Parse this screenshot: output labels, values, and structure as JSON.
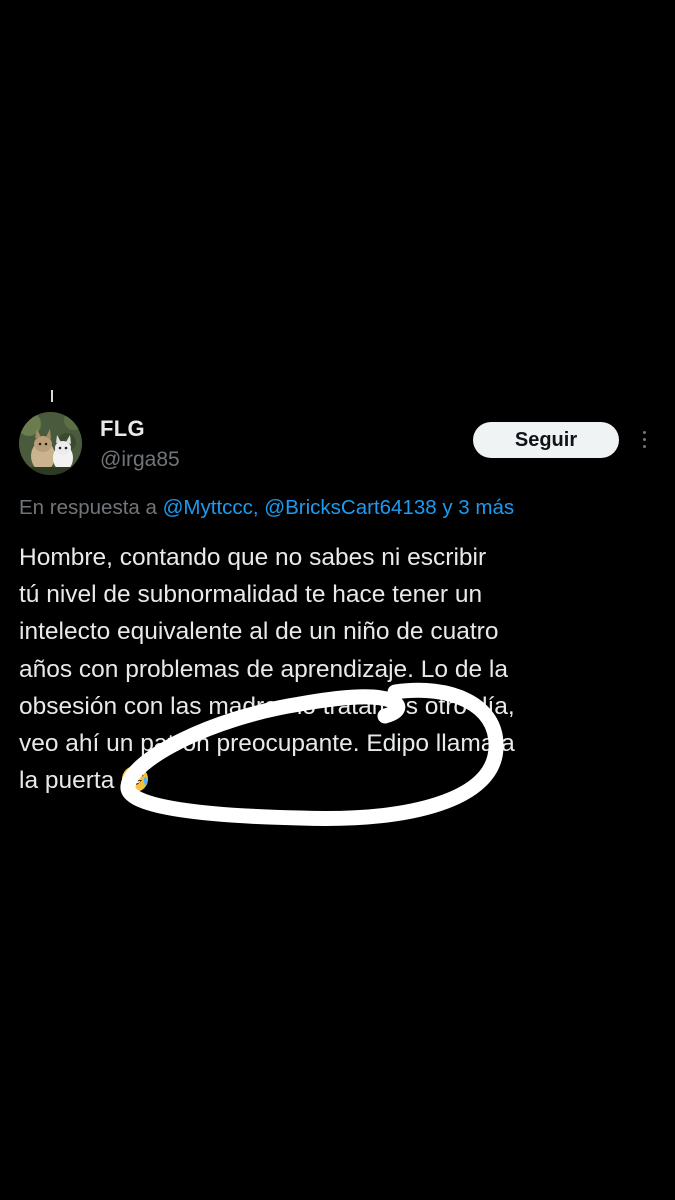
{
  "tweet": {
    "display_name": "FLG",
    "handle": "@irga85",
    "follow_label": "Seguir",
    "reply_prefix": "En respuesta a",
    "reply_mentions": "@Myttccc, @BricksCart64138",
    "reply_and": "y",
    "reply_more": "3 más",
    "body_lines": [
      "Hombre, contando que no sabes ni escribir",
      "tú nivel de subnormalidad te hace tener un",
      "intelecto equivalente al de un niño de cuatro",
      "años con problemas de aprendizaje. Lo de la",
      "obsesión con las madres lo tratamos otro día,",
      "veo ahí un patrón  preocupante. Edipo llama a",
      "la puerta"
    ]
  },
  "icons": {
    "more": "more-vertical-icon",
    "emoji": "face-with-tears-of-joy-icon"
  },
  "colors": {
    "background": "#000000",
    "text_primary": "#e7e9ea",
    "text_secondary": "#71767b",
    "link": "#1d9bf0",
    "follow_button_bg": "#eff3f4",
    "annotation_stroke": "#ffffff"
  }
}
